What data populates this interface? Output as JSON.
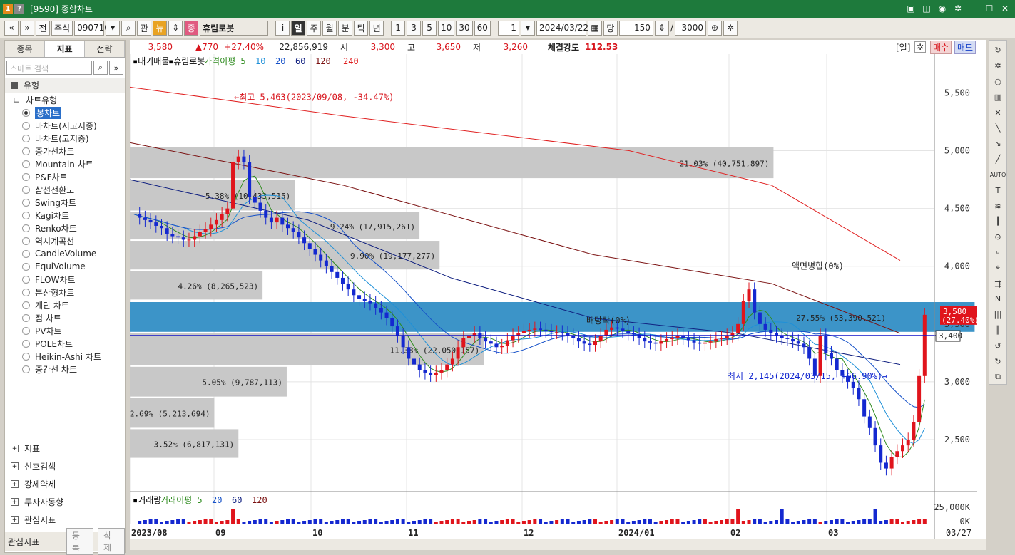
{
  "window": {
    "title": "[9590] 종합차트",
    "icon1": "1",
    "icon2": "?"
  },
  "toolbar": {
    "nav_prev": "«",
    "nav_down": "»",
    "all": "전",
    "market": "주식",
    "code": "090710",
    "code_dropdown": "▾",
    "search": "🔍",
    "relate": "관",
    "news": "뉴",
    "stock_badge": "종",
    "stock_name": "휴림로봇",
    "info": "i",
    "periods": [
      "일",
      "주",
      "월",
      "분",
      "틱",
      "년"
    ],
    "active_period": "일",
    "minutes": [
      "1",
      "3",
      "5",
      "10",
      "30",
      "60"
    ],
    "count_small": "1",
    "date": "2024/03/22",
    "current_label": "당",
    "view_count": "150",
    "slash": "/",
    "total_count": "3000"
  },
  "price_header": {
    "current": "3,580",
    "change": "▲770",
    "change_pct": "+27.40%",
    "volume": "22,856,919",
    "open_label": "시",
    "open": "3,300",
    "high_label": "고",
    "high": "3,650",
    "low_label": "저",
    "low": "3,260",
    "strength_label": "체결강도",
    "strength": "112.53",
    "day_badge": "[일]",
    "buy": "매수",
    "sell": "매도"
  },
  "left_panel": {
    "tabs": [
      "종목",
      "지표",
      "전략"
    ],
    "active_tab": "지표",
    "search_placeholder": "스마트 검색",
    "section": "유형",
    "subsection": "차트유형",
    "chart_types": [
      "봉차트",
      "바차트(시고저종)",
      "바차트(고저종)",
      "종가선차트",
      "Mountain 차트",
      "P&F차트",
      "삼선전환도",
      "Swing차트",
      "Kagi차트",
      "Renko차트",
      "역시계곡선",
      "CandleVolume",
      "EquiVolume",
      "FLOW차트",
      "분산형차트",
      "계단 차트",
      "점 차트",
      "PV차트",
      "POLE차트",
      "Heikin-Ashi 차트",
      "중간선 차트"
    ],
    "selected_type": "봉차트",
    "bottom_items": [
      "지표",
      "신호검색",
      "강세약세",
      "투자자동향",
      "관심지표"
    ],
    "footer_label": "관심지표",
    "footer_btn1": "등록",
    "footer_btn2": "삭제"
  },
  "legend": {
    "items": [
      "대기매물",
      "휴림로봇",
      "가격이평 5",
      "10",
      "20",
      "60",
      "120",
      "240"
    ],
    "colors": [
      "#000000",
      "#000000",
      "#2e8b1e",
      "#1e90d8",
      "#1450c8",
      "#102080",
      "#7a1010",
      "#e02020"
    ]
  },
  "volume_legend": {
    "items": [
      "거래량",
      "거래이평 5",
      "20",
      "60",
      "120"
    ],
    "colors": [
      "#000000",
      "#2e8b1e",
      "#1450c8",
      "#102080",
      "#7a1010"
    ]
  },
  "chart_data": {
    "type": "candlestick",
    "y_axis": [
      "5,500",
      "5,000",
      "4,500",
      "4,000",
      "3,500",
      "3,000",
      "2,500"
    ],
    "y_ticks": [
      5500,
      5000,
      4500,
      4000,
      3500,
      3000,
      2500
    ],
    "ylim": [
      2050,
      5700
    ],
    "x_labels": [
      "2023/08",
      "09",
      "10",
      "11",
      "12",
      "2024/01",
      "02",
      "03"
    ],
    "vol_axis": [
      "25,000K",
      "0K"
    ],
    "current_price_label": "3,580",
    "current_pct_label": "(27.40%)",
    "crosshair_label": "3,400",
    "crosshair_value": 3400,
    "date_label": "03/27",
    "annotations": {
      "high": "최고 5,463(2023/09/08, -34.47%)",
      "low": "최저 2,145(2024/03/15, +66.90%)",
      "split": "액면병합(0%)",
      "dividend": "배당락(0%)"
    },
    "volume_profile": [
      {
        "label": "21.03% (40,751,897)",
        "low": 4750,
        "high": 5030,
        "share": 0.8
      },
      {
        "label": "5.38% (10,433,515)",
        "low": 4470,
        "high": 4750,
        "share": 0.205
      },
      {
        "label": "9.24% (17,915,261)",
        "low": 4220,
        "high": 4470,
        "share": 0.36
      },
      {
        "label": "9.90% (19,177,277)",
        "low": 3960,
        "high": 4220,
        "share": 0.385
      },
      {
        "label": "4.26% (8,265,523)",
        "low": 3700,
        "high": 3960,
        "share": 0.165
      },
      {
        "label": "27.55% (53,390,521)",
        "low": 3420,
        "high": 3690,
        "share": 1.05,
        "highlight": true
      },
      {
        "label": "11.38% (22,050,157)",
        "low": 3130,
        "high": 3420,
        "share": 0.44
      },
      {
        "label": "5.05% (9,787,113)",
        "low": 2860,
        "high": 3130,
        "share": 0.195
      },
      {
        "label": "2.69% (5,213,694)",
        "low": 2590,
        "high": 2860,
        "share": 0.105
      },
      {
        "label": "3.52% (6,817,131)",
        "low": 2330,
        "high": 2590,
        "share": 0.135
      }
    ]
  }
}
